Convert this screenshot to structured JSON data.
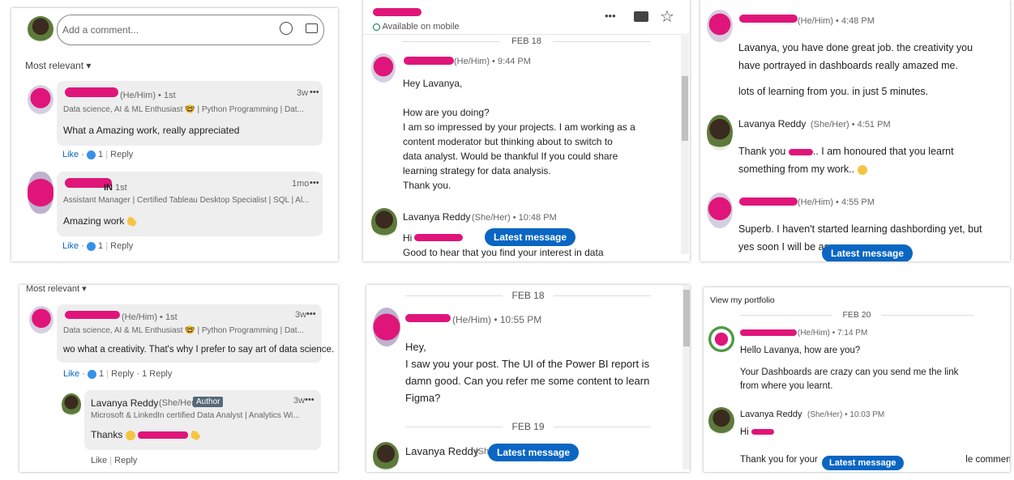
{
  "p1": {
    "comment_placeholder": "Add a comment...",
    "sort_label": "Most relevant",
    "comments": [
      {
        "pronoun": "(He/Him) • 1st",
        "time": "3w",
        "headline": "Data science, AI & ML Enthusiast 🤓 | Python Programming | Dat...",
        "text": "What a Amazing work, really appreciated",
        "like": "Like",
        "count": "1",
        "reply": "Reply"
      },
      {
        "pronoun": "1st",
        "name_tail": "IN",
        "time": "1mo",
        "headline": "Assistant Manager | Certified Tableau Desktop Specialist | SQL | Al...",
        "text": "Amazing work",
        "like": "Like",
        "count": "1",
        "reply": "Reply"
      }
    ],
    "more": "•••",
    "dot": "·",
    "sep": "|"
  },
  "p2": {
    "status": "Available on mobile",
    "toolbar": {
      "more": "•••"
    },
    "date": "FEB 18",
    "m1_meta": "(He/Him) • 9:44 PM",
    "m1_lines": [
      "Hey Lavanya,",
      "",
      "How are you doing?",
      "I am so impressed by your projects. I am working as a",
      "content moderator but thinking about to switch to",
      "data analyst. Would be thankful If you could share",
      "learning strategy for data analysis.",
      "Thank you."
    ],
    "m2_name": "Lavanya Reddy",
    "m2_meta": "(She/Her) • 10:48 PM",
    "m2_line1": "Hi",
    "m2_line2": "Good to hear that you find your interest in data",
    "latest": "Latest message"
  },
  "p3": {
    "m1_meta": "(He/Him) • 4:48 PM",
    "m1_lines": [
      "Lavanya, you have done great job.  the creativity you",
      "have portrayed in dashboards really amazed me.",
      "",
      "lots of learning from you. in just 5 minutes."
    ],
    "m2_name": "Lavanya Reddy",
    "m2_meta": "(She/Her) • 4:51 PM",
    "m2_line1a": "Thank you",
    "m2_line1b": ".. I am honoured that you learnt",
    "m2_line2": "something from my work..",
    "m3_meta": "(He/Him) • 4:55 PM",
    "m3_line1": "Superb. I haven't started learning dashbording yet, but",
    "m3_line2": "yes soon I will be as",
    "latest": "Latest message"
  },
  "p4": {
    "sort_label": "Most relevant",
    "c1_pronoun": "(He/Him) • 1st",
    "c1_time": "3w",
    "c1_headline": "Data science, AI & ML Enthusiast 🤓 | Python Programming | Dat...",
    "c1_text": "wo what a creativity. That's why I prefer to say art of data science.",
    "c1_like": "Like",
    "c1_count": "1",
    "c1_reply": "Reply",
    "c1_replies": "1 Reply",
    "c2_name": "Lavanya Reddy",
    "c2_pronoun": "(She/Her)",
    "c2_badge": "Author",
    "c2_time": "3w",
    "c2_headline": "Microsoft & LinkedIn certified Data Analyst | Analytics Wi...",
    "c2_text": "Thanks",
    "c2_like": "Like",
    "c2_reply": "Reply",
    "more": "•••",
    "dot": "·",
    "sep": "|"
  },
  "p5": {
    "date1": "FEB 18",
    "m1_meta": "(He/Him) • 10:55 PM",
    "m1_lines": [
      "Hey,",
      "I saw you your post. The UI of the Power BI report is",
      "damn good. Can you refer me some content to learn",
      "Figma?"
    ],
    "date2": "FEB 19",
    "m2_name": "Lavanya Reddy",
    "m2_meta": "(Sh",
    "latest": "Latest message"
  },
  "p6": {
    "title": "View my portfolio",
    "date": "FEB 20",
    "m1_meta": "(He/Him) • 7:14 PM",
    "m1_lines": [
      "Hello Lavanya, how are you?",
      "",
      "Your Dashboards are crazy can you send me the link",
      "from where you learnt."
    ],
    "m2_name": "Lavanya Reddy",
    "m2_meta": "(She/Her) • 10:03 PM",
    "m2_line1": "Hi",
    "m2_line2a": "Thank you for your",
    "m2_line2b": "le comments",
    "latest": "Latest message"
  },
  "colors": {
    "brand": "#0a66c2",
    "redact": "#e0157a"
  }
}
